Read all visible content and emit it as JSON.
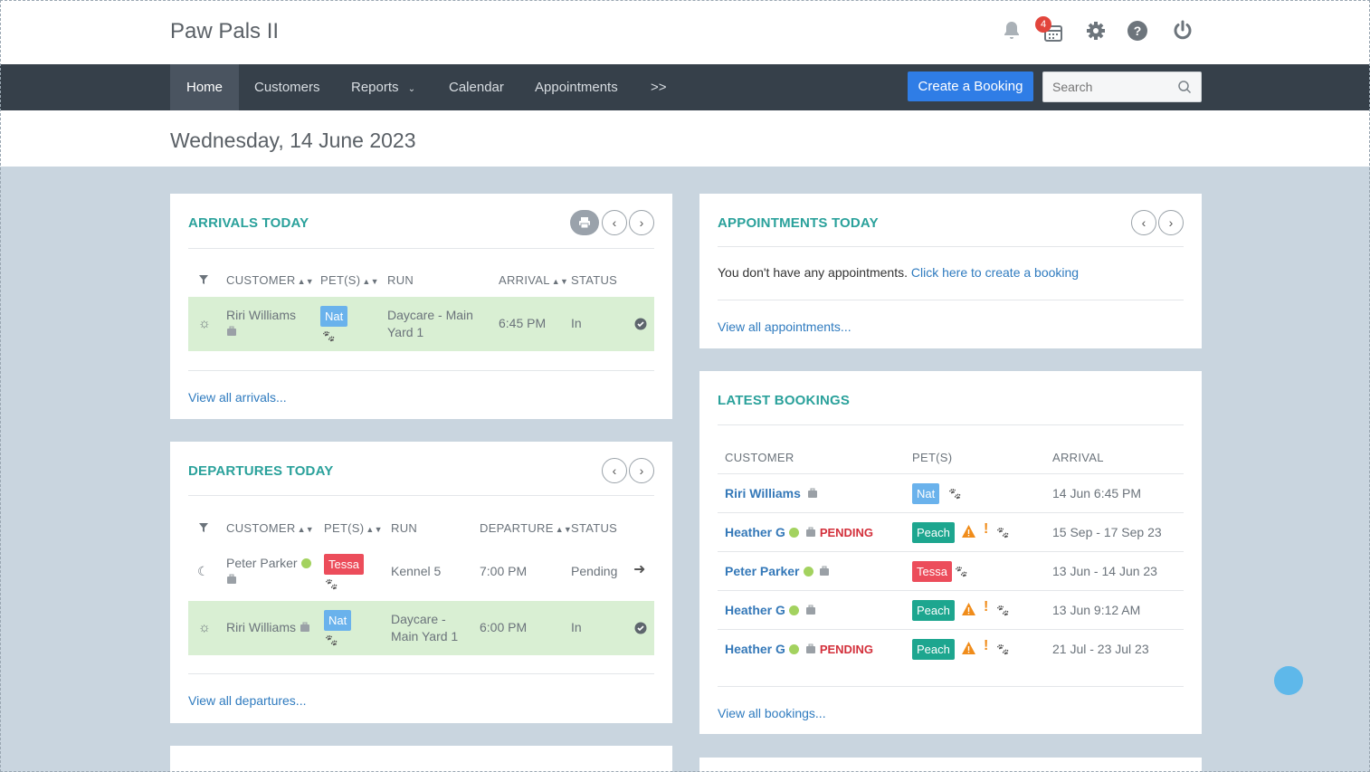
{
  "app": {
    "title": "Paw Pals II",
    "notification_count": "4",
    "icons": [
      "bell-icon",
      "calendar-icon",
      "gear-icon",
      "help-icon",
      "power-icon"
    ]
  },
  "nav": {
    "items": [
      "Home",
      "Customers",
      "Reports",
      "Calendar",
      "Appointments",
      ">>"
    ],
    "active": "Home",
    "create_booking": "Create a Booking",
    "search_placeholder": "Search"
  },
  "date": "Wednesday, 14 June 2023",
  "arrivals": {
    "title": "ARRIVALS TODAY",
    "columns": [
      "CUSTOMER",
      "PET(S)",
      "RUN",
      "ARRIVAL",
      "STATUS"
    ],
    "rows": [
      {
        "customer": "Riri Williams",
        "pet": "Nat",
        "run_line1": "Daycare - Main",
        "run_line2": "Yard 1",
        "time": "6:45 PM",
        "status": "In"
      }
    ],
    "view_all": "View all arrivals..."
  },
  "departures": {
    "title": "DEPARTURES TODAY",
    "columns": [
      "CUSTOMER",
      "PET(S)",
      "RUN",
      "DEPARTURE",
      "STATUS"
    ],
    "rows": [
      {
        "customer": "Peter Parker",
        "pet": "Tessa",
        "run_line1": "Kennel 5",
        "run_line2": "",
        "time": "7:00 PM",
        "status": "Pending"
      },
      {
        "customer": "Riri Williams",
        "pet": "Nat",
        "run_line1": "Daycare -",
        "run_line2": "Main Yard 1",
        "time": "6:00 PM",
        "status": "In"
      }
    ],
    "view_all": "View all departures..."
  },
  "appointments": {
    "title": "APPOINTMENTS TODAY",
    "empty_text": "You don't have any appointments.",
    "create_link": "Click here to create a booking",
    "view_all": "View all appointments..."
  },
  "bookings": {
    "title": "LATEST BOOKINGS",
    "columns": [
      "CUSTOMER",
      "PET(S)",
      "ARRIVAL"
    ],
    "rows": [
      {
        "customer": "Riri Williams",
        "pending": "",
        "pet": "Nat",
        "arrival": "14 Jun 6:45 PM"
      },
      {
        "customer": "Heather G",
        "pending": "PENDING",
        "pet": "Peach",
        "arrival": "15 Sep - 17 Sep 23"
      },
      {
        "customer": "Peter Parker",
        "pending": "",
        "pet": "Tessa",
        "arrival": "13 Jun - 14 Jun 23"
      },
      {
        "customer": "Heather G",
        "pending": "",
        "pet": "Peach",
        "arrival": "13 Jun 9:12 AM"
      },
      {
        "customer": "Heather G",
        "pending": "PENDING",
        "pet": "Peach",
        "arrival": "21 Jul - 23 Jul 23"
      }
    ],
    "view_all": "View all bookings..."
  },
  "colors": {
    "accent": "#2aa19b",
    "navbar": "#36404a",
    "primary_button": "#2f7de6",
    "row_highlight": "#d9efd3",
    "pending": "#d3303b"
  }
}
